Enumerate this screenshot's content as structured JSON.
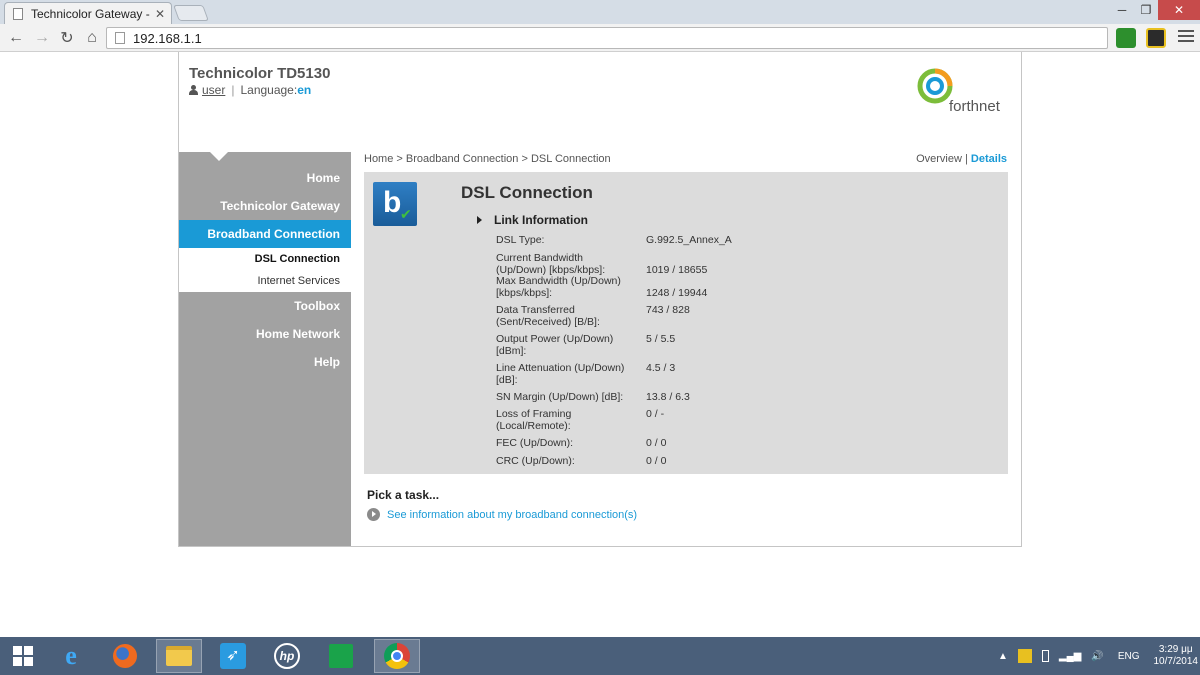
{
  "browser": {
    "tab_title": "Technicolor Gateway - DS",
    "url": "192.168.1.1"
  },
  "header": {
    "title": "Technicolor TD5130",
    "user_label": "user",
    "language_label": "Language:",
    "language_value": "en",
    "logo_text": "forthnet"
  },
  "sidebar": {
    "items": [
      {
        "label": "Home"
      },
      {
        "label": "Technicolor Gateway"
      },
      {
        "label": "Broadband Connection"
      },
      {
        "label": "Toolbox"
      },
      {
        "label": "Home Network"
      },
      {
        "label": "Help"
      }
    ],
    "sub_items": [
      {
        "label": "DSL Connection"
      },
      {
        "label": "Internet Services"
      }
    ]
  },
  "breadcrumb": {
    "text": "Home > Broadband Connection > DSL Connection"
  },
  "view_switch": {
    "overview": "Overview",
    "separator": "|",
    "details": "Details"
  },
  "card": {
    "title": "DSL Connection",
    "section": "Link Information",
    "rows": [
      {
        "label": "DSL Type:",
        "value": "G.992.5_Annex_A"
      },
      {
        "label": "Current Bandwidth (Up/Down) [kbps/kbps]:",
        "value": "1019 / 18655"
      },
      {
        "label": "Max Bandwidth (Up/Down) [kbps/kbps]:",
        "value": "1248 / 19944"
      },
      {
        "label": "Data Transferred (Sent/Received) [B/B]:",
        "value": "743 / 828"
      },
      {
        "label": "Output Power (Up/Down) [dBm]:",
        "value": "5 / 5.5"
      },
      {
        "label": "Line Attenuation (Up/Down) [dB]:",
        "value": "4.5 / 3"
      },
      {
        "label": "SN Margin (Up/Down) [dB]:",
        "value": "13.8 / 6.3"
      },
      {
        "label": "Loss of Framing (Local/Remote):",
        "value": "0 / -"
      },
      {
        "label": "FEC (Up/Down):",
        "value": "0 / 0"
      },
      {
        "label": "CRC (Up/Down):",
        "value": "0 / 0"
      }
    ]
  },
  "tasks": {
    "title": "Pick a task...",
    "link": "See information about my broadband connection(s)"
  },
  "taskbar": {
    "language": "ENG",
    "time": "3:29 μμ",
    "date": "10/7/2014"
  },
  "colors": {
    "accent": "#1a9ad6",
    "sidebar": "#a2a2a2",
    "card": "#dcdcdc"
  }
}
